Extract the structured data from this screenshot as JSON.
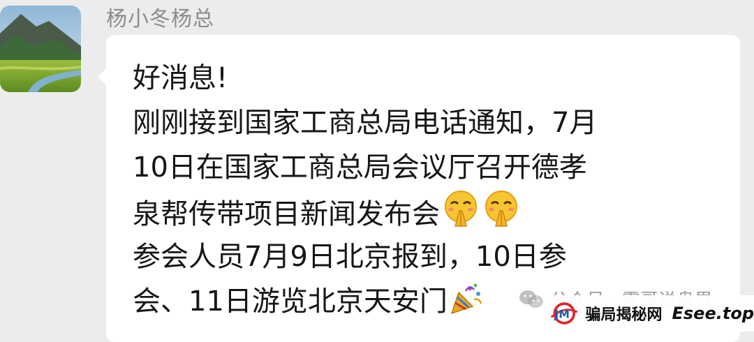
{
  "chat": {
    "sender_name": "杨小冬杨总",
    "avatar": "landscape-avatar",
    "message_lines": [
      "好消息!",
      "刚刚接到国家工商总局电话通知，7月",
      "10日在国家工商总局会议厅召开德孝",
      "泉帮传带项目新闻发布会",
      "参会人员7月9日北京报到，10日参",
      "会、11日游览北京天安门"
    ],
    "emojis": [
      "praying-smile-emoji",
      "praying-smile-emoji",
      "party-popper-emoji"
    ]
  },
  "watermarks": {
    "wechat_text": "公众号 · 震哥说盘界",
    "site_name": "骗局揭秘网",
    "site_domain": "Esee.top"
  },
  "colors": {
    "background": "#ececec",
    "bubble": "#ffffff",
    "text": "#161616",
    "sender_name": "#8c8c8c",
    "logo_red": "#e0262b",
    "logo_blue": "#1f5ba8"
  }
}
